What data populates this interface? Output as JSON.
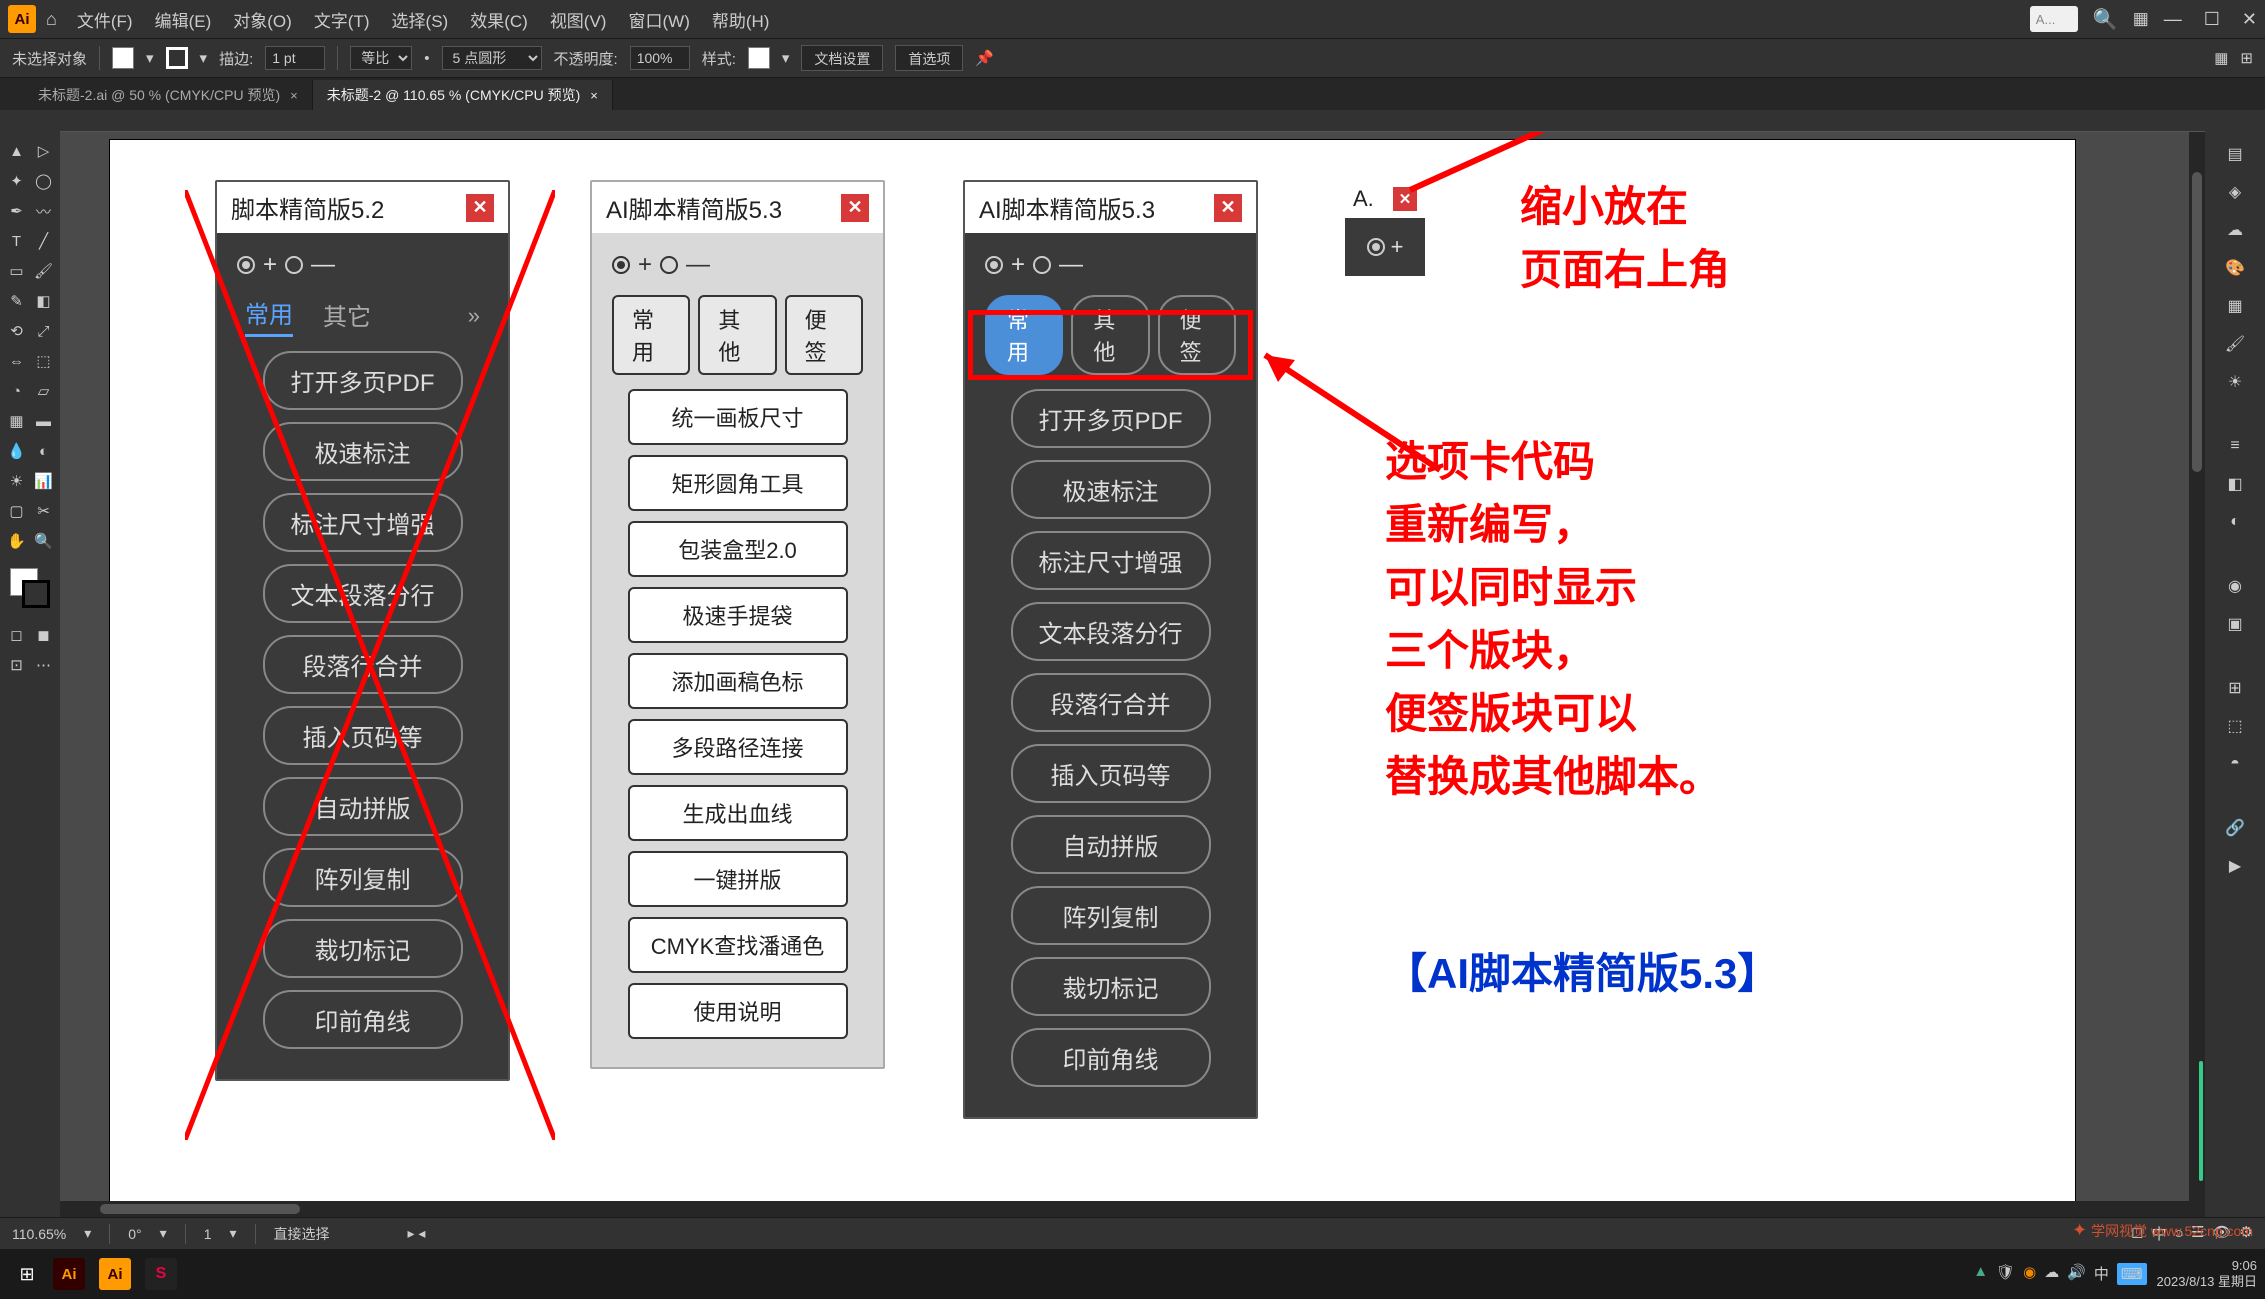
{
  "menubar": {
    "items": [
      "文件(F)",
      "编辑(E)",
      "对象(O)",
      "文字(T)",
      "选择(S)",
      "效果(C)",
      "视图(V)",
      "窗口(W)",
      "帮助(H)"
    ],
    "search_placeholder": "A..."
  },
  "controlbar": {
    "no_selection": "未选择对象",
    "stroke_label": "描边:",
    "stroke_value": "1 pt",
    "uniform": "等比",
    "pt_round": "5 点圆形",
    "opacity_label": "不透明度:",
    "opacity_value": "100%",
    "style_label": "样式:",
    "doc_setup": "文档设置",
    "prefs": "首选项"
  },
  "tabs": [
    {
      "label": "未标题-2.ai @ 50 % (CMYK/CPU 预览)",
      "active": false
    },
    {
      "label": "未标题-2 @ 110.65 % (CMYK/CPU 预览)",
      "active": true
    }
  ],
  "panel52": {
    "title": "脚本精简版5.2",
    "tabs": [
      "常用",
      "其它"
    ],
    "buttons": [
      "打开多页PDF",
      "极速标注",
      "标注尺寸增强",
      "文本段落分行",
      "段落行合并",
      "插入页码等",
      "自动拼版",
      "阵列复制",
      "裁切标记",
      "印前角线"
    ]
  },
  "panel53_light": {
    "title": "AI脚本精简版5.3",
    "tabs": [
      "常用",
      "其他",
      "便签"
    ],
    "buttons": [
      "统一画板尺寸",
      "矩形圆角工具",
      "包装盒型2.0",
      "极速手提袋",
      "添加画稿色标",
      "多段路径连接",
      "生成出血线",
      "一键拼版",
      "CMYK查找潘通色",
      "使用说明"
    ]
  },
  "panel53_dark": {
    "title": "AI脚本精简版5.3",
    "tabs": [
      "常用",
      "其他",
      "便签"
    ],
    "buttons": [
      "打开多页PDF",
      "极速标注",
      "标注尺寸增强",
      "文本段落分行",
      "段落行合并",
      "插入页码等",
      "自动拼版",
      "阵列复制",
      "裁切标记",
      "印前角线"
    ]
  },
  "panel_mini": {
    "title": "A."
  },
  "annotations": {
    "top_line1": "缩小放在",
    "top_line2": "页面右上角",
    "mid_text": "选项卡代码\n重新编写，\n可以同时显示\n三个版块，\n便签版块可以\n替换成其他脚本。",
    "blue_text": "【AI脚本精简版5.3】"
  },
  "statusbar": {
    "zoom": "110.65%",
    "rotate": "0°",
    "coord": "1",
    "tool": "直接选择"
  },
  "taskbar": {
    "time": "9:06",
    "date": "2023/8/13 星期日",
    "ime": "中"
  },
  "watermark": "学网视觉 www.52cnp.com"
}
